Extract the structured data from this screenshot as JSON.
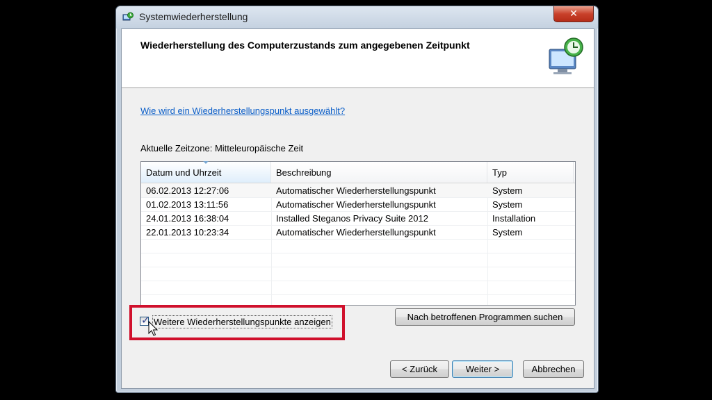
{
  "window": {
    "title": "Systemwiederherstellung",
    "close_label": "✕"
  },
  "header": {
    "title": "Wiederherstellung des Computerzustands zum angegebenen Zeitpunkt"
  },
  "help_link": "Wie wird ein Wiederherstellungspunkt ausgewählt?",
  "timezone": "Aktuelle Zeitzone: Mitteleuropäische Zeit",
  "table": {
    "columns": [
      "Datum und Uhrzeit",
      "Beschreibung",
      "Typ"
    ],
    "rows": [
      {
        "date": "06.02.2013 12:27:06",
        "desc": "Automatischer Wiederherstellungspunkt",
        "type": "System"
      },
      {
        "date": "01.02.2013 13:11:56",
        "desc": "Automatischer Wiederherstellungspunkt",
        "type": "System"
      },
      {
        "date": "24.01.2013 16:38:04",
        "desc": "Installed Steganos Privacy Suite 2012",
        "type": "Installation"
      },
      {
        "date": "22.01.2013 10:23:34",
        "desc": "Automatischer Wiederherstellungspunkt",
        "type": "System"
      }
    ]
  },
  "checkbox": {
    "label": "Weitere Wiederherstellungspunkte anzeigen",
    "checked": true
  },
  "buttons": {
    "search": "Nach betroffenen Programmen suchen",
    "back": "< Zurück",
    "next": "Weiter >",
    "cancel": "Abbrechen"
  },
  "colors": {
    "highlight": "#d0102c",
    "link": "#0b5ec8"
  }
}
